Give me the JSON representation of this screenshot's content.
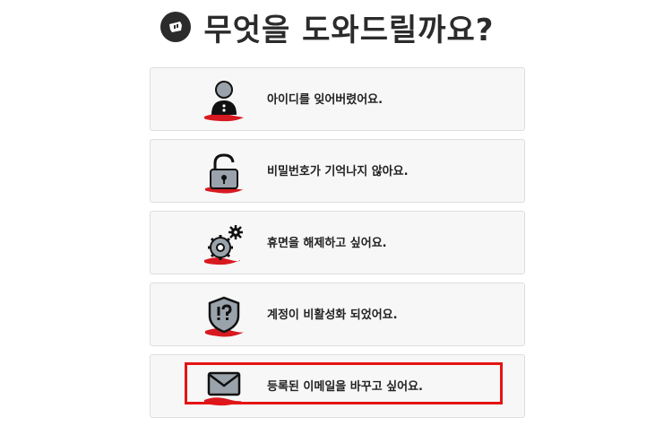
{
  "header": {
    "title": "무엇을 도와드릴까요?",
    "logo_icon": "riot-fist-icon"
  },
  "options": [
    {
      "label": "아이디를 잊어버렸어요.",
      "icon": "user-icon"
    },
    {
      "label": "비밀번호가 기억나지 않아요.",
      "icon": "padlock-icon"
    },
    {
      "label": "휴면을 해제하고 싶어요.",
      "icon": "gears-icon"
    },
    {
      "label": "계정이 비활성화 되었어요.",
      "icon": "shield-question-icon"
    },
    {
      "label": "등록된 이메일을 바꾸고 싶어요.",
      "icon": "envelope-icon"
    }
  ],
  "colors": {
    "accent_red": "#e31414",
    "brush_red": "#d71920",
    "icon_fill": "#9aa3ab",
    "card_bg": "#f7f7f7",
    "text": "#222222"
  }
}
